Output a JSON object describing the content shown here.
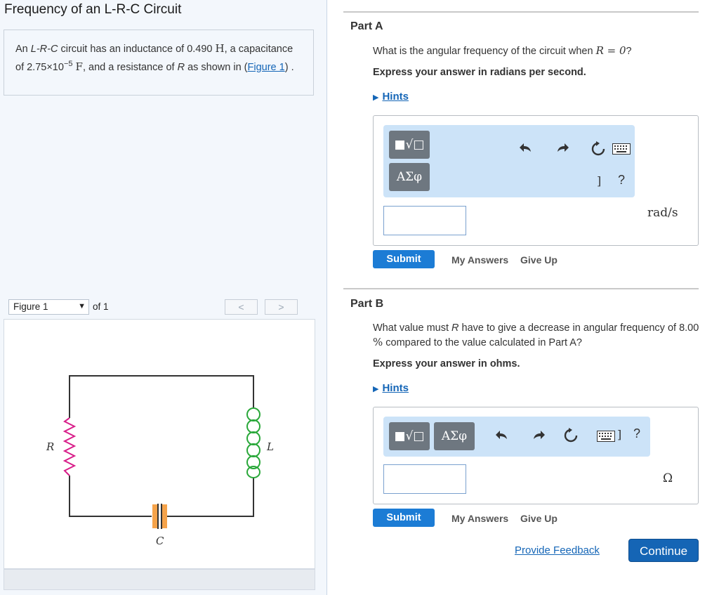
{
  "title": "Frequency of an L-R-C Circuit",
  "problem": {
    "p1": "An ",
    "p1_italic": "L-R-C",
    "p2": " circuit has an inductance of 0.490 ",
    "H": "H",
    "p3": ", a capacitance of 2.75×10",
    "exp": "−5",
    "F": "F",
    "p4": ", and a resistance of ",
    "R": "R",
    "p5": " as shown in (",
    "link": "Figure 1",
    "p6": ") ."
  },
  "figure": {
    "select_label": "Figure 1",
    "caret": "▼",
    "of_label": "of 1",
    "prev": "<",
    "next": ">",
    "labels": {
      "R": "R",
      "L": "L",
      "C": "C"
    }
  },
  "colors": {
    "wire": "#333333",
    "resistor": "#d81e8a",
    "inductor": "#2aa83a",
    "capacitor": "#f5a34a",
    "submit": "#1c7cd5",
    "continue": "#1565b5",
    "toolbar": "#cce3f8"
  },
  "toolbar": {
    "template_icon": "■√□",
    "greek": "ΑΣφ",
    "undo_icon": "undo-arrow",
    "redo_icon": "redo-arrow",
    "reset_icon": "reset-icon",
    "keyboard_icon": "keyboard-icon",
    "bracket": "]",
    "help": "?"
  },
  "partA": {
    "title": "Part A",
    "q1": "What is the angular frequency of the circuit when ",
    "q_math": "R = 0",
    "q2": "?",
    "instruction": "Express your answer in radians per second.",
    "hints": "Hints",
    "unit": "rad/s",
    "input_value": "",
    "submit": "Submit",
    "my_answers": "My Answers",
    "give_up": "Give Up"
  },
  "partB": {
    "title": "Part B",
    "q1": "What value must ",
    "q_R": "R",
    "q2": " have to give a decrease in angular frequency of 8.00 ",
    "q_pct": "%",
    "q3": " compared to the value calculated in Part A?",
    "instruction": "Express your answer in ohms.",
    "hints": "Hints",
    "unit": "Ω",
    "input_value": "",
    "submit": "Submit",
    "my_answers": "My Answers",
    "give_up": "Give Up"
  },
  "footer": {
    "feedback": "Provide Feedback",
    "continue": "Continue"
  }
}
